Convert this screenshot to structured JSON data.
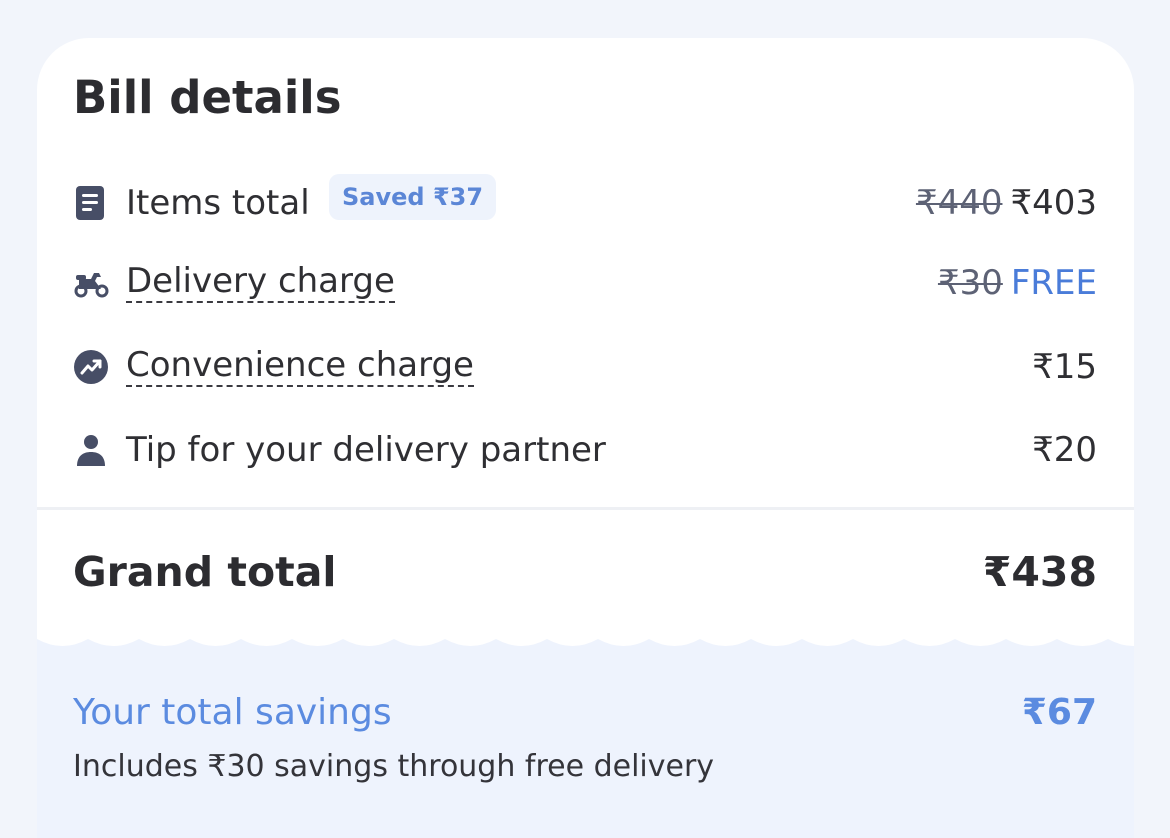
{
  "bill": {
    "title": "Bill details",
    "items_total": {
      "label": "Items total",
      "badge": "Saved ₹37",
      "original": "₹440",
      "amount": "₹403",
      "icon": "receipt-icon"
    },
    "delivery": {
      "label": "Delivery charge",
      "original": "₹30",
      "amount": "FREE",
      "icon": "scooter-icon"
    },
    "convenience": {
      "label": "Convenience charge",
      "amount": "₹15",
      "icon": "trending-up-icon"
    },
    "tip": {
      "label": "Tip for your delivery partner",
      "amount": "₹20",
      "icon": "person-icon"
    },
    "grand_total": {
      "label": "Grand total",
      "amount": "₹438"
    },
    "savings": {
      "label": "Your total savings",
      "amount": "₹67",
      "note": "Includes ₹30 savings through free delivery"
    }
  },
  "colors": {
    "accent": "#5b8be0",
    "text": "#2f2f33",
    "icon": "#474e66",
    "background": "#f2f5fb"
  }
}
